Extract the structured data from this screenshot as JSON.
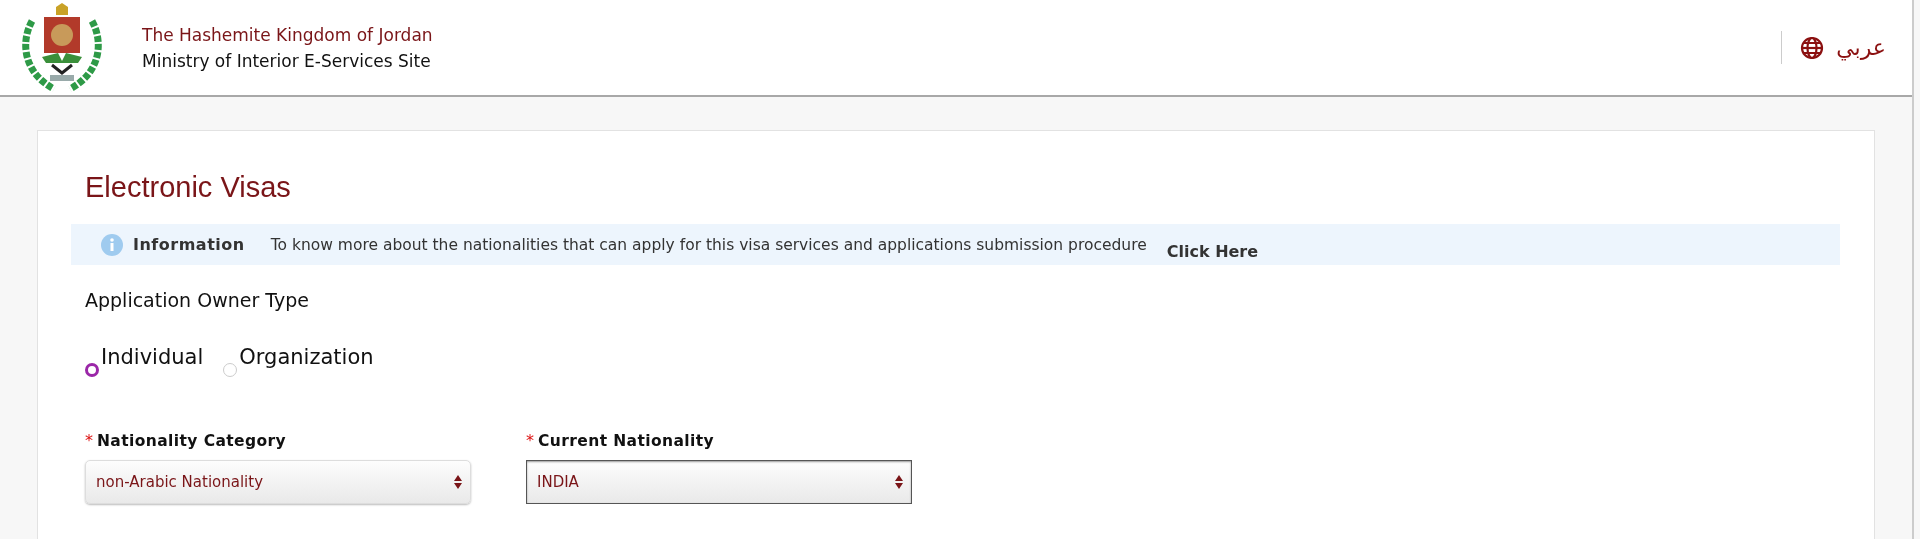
{
  "header": {
    "country": "The Hashemite Kingdom of Jordan",
    "site": "Ministry of Interior E-Services Site",
    "language_link": "عربي"
  },
  "page": {
    "title": "Electronic Visas",
    "info": {
      "label": "Information",
      "text": "To know more about the nationalities that can apply for this visa services and applications submission procedure",
      "link": "Click Here"
    },
    "owner_type": {
      "label": "Application Owner Type",
      "options": [
        {
          "label": "Individual",
          "selected": true
        },
        {
          "label": "Organization",
          "selected": false
        }
      ]
    },
    "fields": [
      {
        "label": "Nationality Category",
        "required_mark": "*",
        "value": "non-Arabic Nationality",
        "focused": false
      },
      {
        "label": "Current Nationality",
        "required_mark": "*",
        "value": "INDIA",
        "focused": true
      }
    ]
  }
}
